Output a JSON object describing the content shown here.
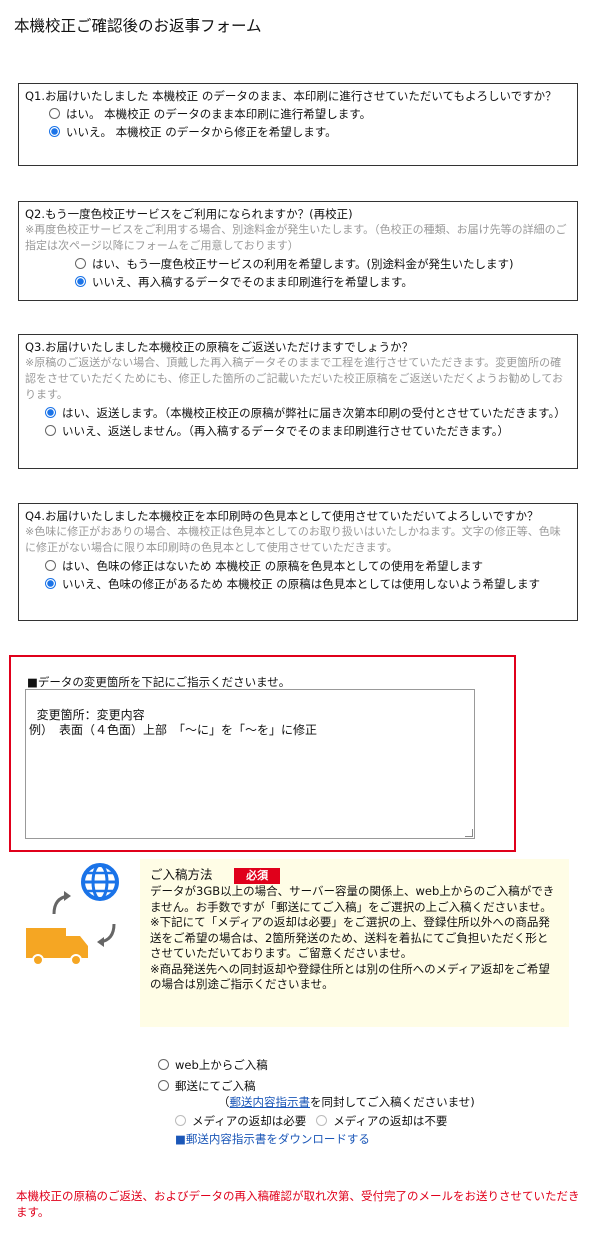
{
  "page": {
    "title": "本機校正ご確認後のお返事フォーム"
  },
  "q1": {
    "question": "Q1.お届けいたしました 本機校正 のデータのまま、本印刷に進行させていただいてもよろしいですか？",
    "options": [
      {
        "label": "はい。 本機校正 のデータのまま本印刷に進行希望します。",
        "checked": false
      },
      {
        "label": "いいえ。 本機校正 のデータから修正を希望します。",
        "checked": true
      }
    ]
  },
  "q2": {
    "question": "Q2.もう一度色校正サービスをご利用になられますか？(再校正)",
    "note": "※再度色校正サービスをご利用する場合、別途料金が発生いたします。（色校正の種類、お届け先等の詳細のご指定は次ページ以降にフォームをご用意しております）",
    "options": [
      {
        "label": "はい、もう一度色校正サービスの利用を希望します。(別途料金が発生いたします)",
        "checked": false
      },
      {
        "label": "いいえ、再入稿するデータでそのまま印刷進行を希望します。",
        "checked": true
      }
    ]
  },
  "q3": {
    "question": "Q3.お届けいたしました本機校正の原稿をご返送いただけますでしょうか？",
    "note": "※原稿のご返送がない場合、頂戴した再入稿データそのままで工程を進行させていただきます。変更箇所の確認をさせていただくためにも、修正した箇所のご記載いただいた校正原稿をご返送いただくようお勧めしております。",
    "options": [
      {
        "label": "はい、返送します。（本機校正校正の原稿が弊社に届き次第本印刷の受付とさせていただきます。）",
        "checked": true
      },
      {
        "label": "いいえ、返送しません。（再入稿するデータでそのまま印刷進行させていただきます。）",
        "checked": false
      }
    ]
  },
  "q4": {
    "question": "Q4.お届けいたしました本機校正を本印刷時の色見本として使用させていただいてよろしいですか？",
    "note": "※色味に修正がおありの場合、本機校正は色見本としてのお取り扱いはいたしかねます。文字の修正等、色味に修正がない場合に限り本印刷時の色見本として使用させていただきます。",
    "options": [
      {
        "label": "はい、色味の修正はないため 本機校正 の原稿を色見本としての使用を希望します",
        "checked": false
      },
      {
        "label": "いいえ、色味の修正があるため 本機校正 の原稿は色見本としては使用しないよう希望します",
        "checked": true
      }
    ]
  },
  "changes": {
    "label": "■データの変更箇所を下記にご指示くださいませ。",
    "value": "変更箇所：変更内容\n例）　表面（４色面）上部　「～に」を「～を」に修正"
  },
  "submission": {
    "heading": "ご入稿方法",
    "required_badge": "必須",
    "body1": "データが3GB以上の場合、サーバー容量の関係上、web上からのご入稿ができません。お手数ですが「郵送にてご入稿」をご選択の上ご入稿くださいませ。",
    "body2": "※下記にて「メディアの返却は必要」をご選択の上、登録住所以外への商品発送をご希望の場合は、2箇所発送のため、送料を着払にてご負担いただく形とさせていただいております。ご留意くださいませ。",
    "body3": "※商品発送先への同封返却や登録住所とは別の住所へのメディア返却をご希望の場合は別途ご指示くださいませ。",
    "icons": [
      "globe-icon",
      "truck-icon",
      "arrow-icon"
    ],
    "options": [
      {
        "label": "web上からご入稿",
        "checked": false
      },
      {
        "label": "郵送にてご入稿",
        "checked": false
      }
    ],
    "mail_note_prefix": "（",
    "mail_note_link": "郵送内容指示書",
    "mail_note_suffix": "を同封してご入稿くださいませ)",
    "media_options": [
      {
        "label": "メディアの返却は必要",
        "checked": false
      },
      {
        "label": "メディアの返却は不要",
        "checked": false
      }
    ],
    "download_link": "■郵送内容指示書をダウンロードする"
  },
  "footer": {
    "message": "本機校正の原稿のご返送、およびデータの再入稿確認が取れ次第、受付完了のメールをお送りさせていただきます。"
  },
  "colors": {
    "accent_blue": "#1a73e8",
    "required_red": "#e0001b",
    "note_gray": "#999999",
    "panel_yellow": "#fffde6",
    "truck_orange": "#f5a623"
  }
}
